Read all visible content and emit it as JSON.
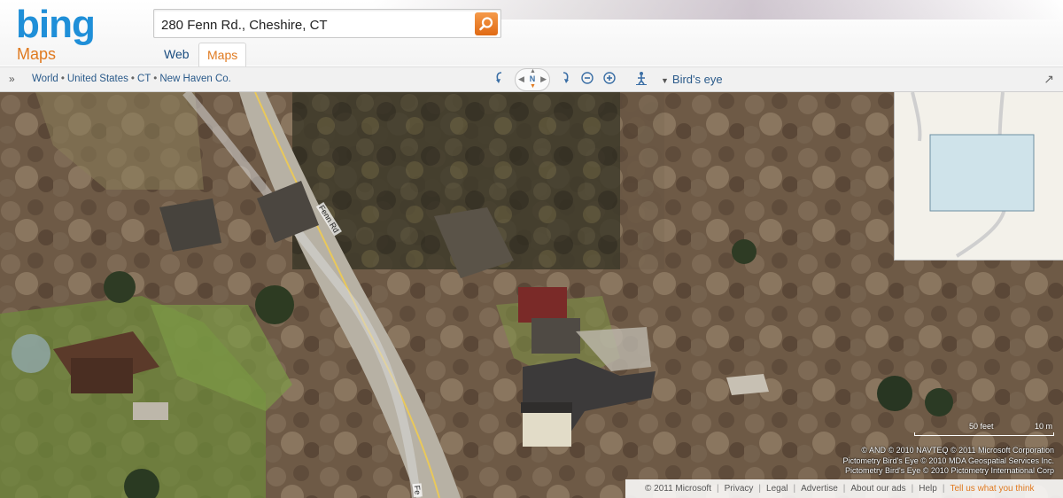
{
  "brand": {
    "logo_text": "bing",
    "section": "Maps"
  },
  "search": {
    "value": "280 Fenn Rd., Cheshire, CT"
  },
  "tabs": [
    {
      "label": "Web"
    },
    {
      "label": "Maps"
    }
  ],
  "breadcrumb": [
    "World",
    "United States",
    "CT",
    "New Haven Co."
  ],
  "toolbar": {
    "compass_label": "N",
    "view_mode": "Bird's eye"
  },
  "map": {
    "road_labels": [
      "Fenn Rd",
      "Fe"
    ],
    "scale": {
      "left_label": "50 feet",
      "right_label": "10 m"
    },
    "copyright_lines": [
      "© AND  © 2010 NAVTEQ  © 2011 Microsoft Corporation",
      "Pictometry Bird's Eye © 2010 MDA Geospatial Services Inc.",
      "Pictometry Bird's Eye © 2010 Pictometry International Corp"
    ]
  },
  "footer": {
    "copyright": "© 2011 Microsoft",
    "links": [
      "Privacy",
      "Legal",
      "Advertise",
      "About our ads",
      "Help"
    ],
    "feedback": "Tell us what you think"
  },
  "colors": {
    "brand_blue": "#1f8fd8",
    "accent_orange": "#e07a20"
  }
}
